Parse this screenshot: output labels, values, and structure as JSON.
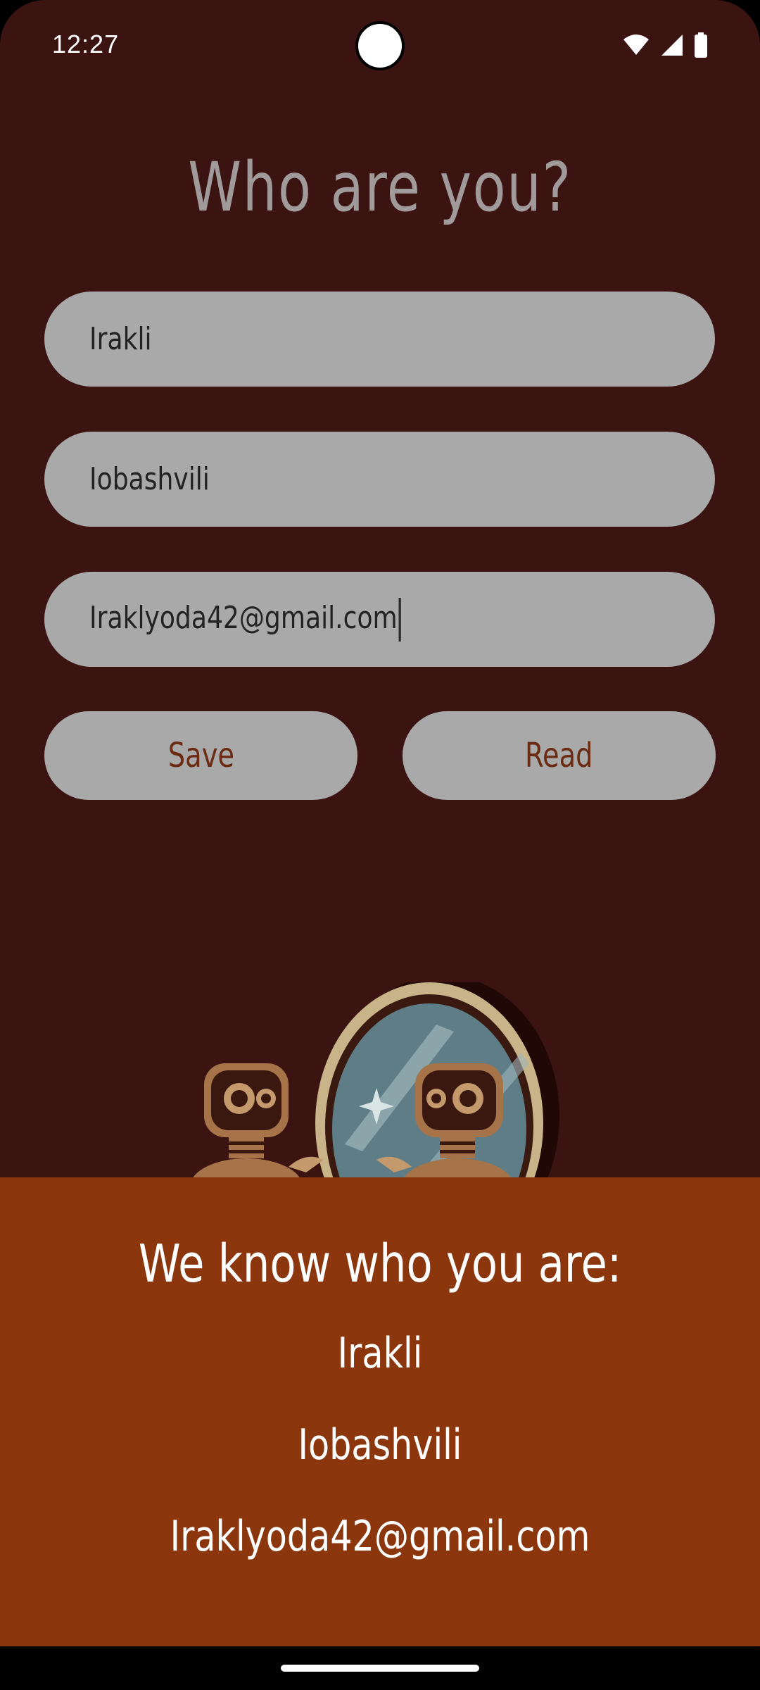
{
  "status_bar": {
    "time": "12:27",
    "icons": [
      "wifi-icon",
      "signal-icon",
      "battery-icon"
    ]
  },
  "form": {
    "title": "Who are you?",
    "first_name": "Irakli",
    "last_name": "Iobashvili",
    "email": "Iraklyoda42@gmail.com"
  },
  "buttons": {
    "save_label": "Save",
    "read_label": "Read"
  },
  "result": {
    "title": "We know who you are:",
    "first_name": "Irakli",
    "last_name": "Iobashvili",
    "email": "Iraklyoda42@gmail.com"
  },
  "colors": {
    "background": "#3b1412",
    "field": "#a9a9a9",
    "panel": "#8b360c",
    "button_text": "#6b2a12"
  }
}
